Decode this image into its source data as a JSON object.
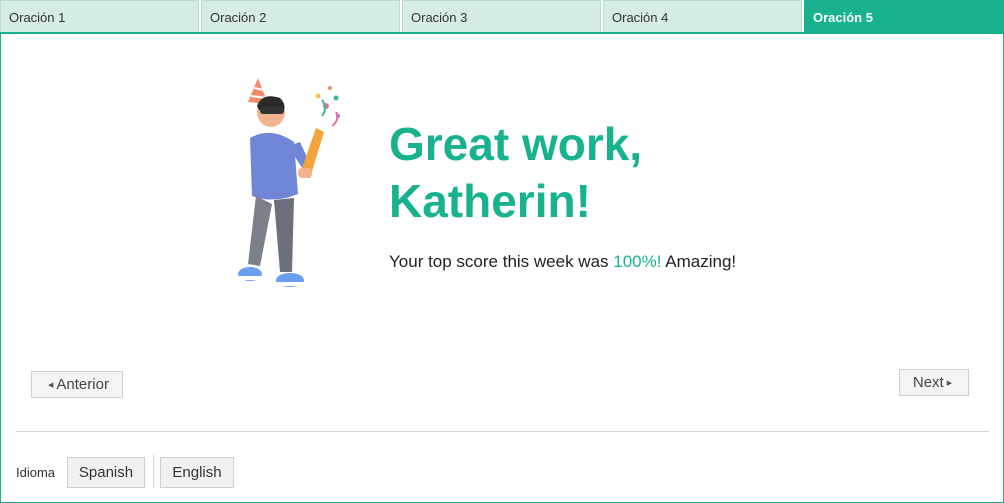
{
  "tabs": [
    {
      "label": "Oración 1",
      "active": false
    },
    {
      "label": "Oración 2",
      "active": false
    },
    {
      "label": "Oración 3",
      "active": false
    },
    {
      "label": "Oración 4",
      "active": false
    },
    {
      "label": "Oración 5",
      "active": true
    }
  ],
  "congrats": {
    "headline_line1": "Great work,",
    "headline_line2": "Katherin!",
    "message_prefix": "Your top score this week was ",
    "score": "100%!",
    "message_suffix": " Amazing!"
  },
  "navigation": {
    "prev_label": "Anterior",
    "next_label": "Next"
  },
  "language": {
    "label": "Idioma",
    "options": [
      "Spanish",
      "English"
    ]
  },
  "colors": {
    "accent": "#18b38e",
    "tab_inactive": "#d6ece6"
  },
  "icons": {
    "prev": "caret-left-icon",
    "next": "caret-right-icon",
    "illustration": "celebration-party-popper-illustration"
  }
}
